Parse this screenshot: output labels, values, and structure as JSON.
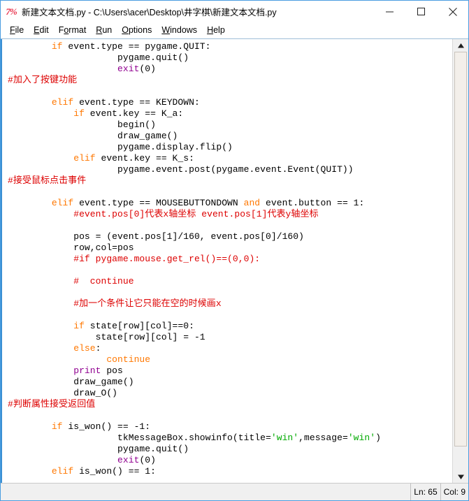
{
  "window": {
    "icon": "python-idle-icon",
    "title": "新建文本文档.py - C:\\Users\\acer\\Desktop\\井字棋\\新建文本文档.py",
    "minimize_label": "minimize-icon",
    "maximize_label": "maximize-icon",
    "close_label": "close-icon"
  },
  "menubar": {
    "items": [
      {
        "label": "File",
        "accel": "F"
      },
      {
        "label": "Edit",
        "accel": "E"
      },
      {
        "label": "Format",
        "accel": "o"
      },
      {
        "label": "Run",
        "accel": "R"
      },
      {
        "label": "Options",
        "accel": "O"
      },
      {
        "label": "Windows",
        "accel": "W"
      },
      {
        "label": "Help",
        "accel": "H"
      }
    ]
  },
  "editor": {
    "language": "python",
    "lines": [
      "        if event.type == pygame.QUIT:",
      "                    pygame.quit()",
      "                    exit(0)",
      "#加入了按键功能",
      "",
      "        elif event.type == KEYDOWN:",
      "            if event.key == K_a:",
      "                    begin()",
      "                    draw_game()",
      "                    pygame.display.flip()",
      "            elif event.key == K_s:",
      "                    pygame.event.post(pygame.event.Event(QUIT))",
      "#接受鼠标点击事件",
      "",
      "        elif event.type == MOUSEBUTTONDOWN and event.button == 1:",
      "            #event.pos[0]代表x轴坐标 event.pos[1]代表y轴坐标",
      "",
      "            pos = (event.pos[1]/160, event.pos[0]/160)",
      "            row,col=pos",
      "            #if pygame.mouse.get_rel()==(0,0):",
      "",
      "            #  continue",
      "",
      "            #加一个条件让它只能在空的时候画x",
      "",
      "            if state[row][col]==0:",
      "                state[row][col] = -1",
      "            else:",
      "                  continue",
      "            print pos",
      "            draw_game()",
      "            draw_O()",
      "#判断属性接受返回值",
      "",
      "        if is_won() == -1:",
      "                    tkMessageBox.showinfo(title='win',message='win')",
      "                    pygame.quit()",
      "                    exit(0)",
      "        elif is_won() == 1:"
    ]
  },
  "scrollbar": {
    "up_arrow": "scroll-up-arrow-icon",
    "down_arrow": "scroll-down-arrow-icon"
  },
  "statusbar": {
    "line_label": "Ln: 65",
    "col_label": "Col: 9"
  },
  "colors": {
    "keyword": "#ff7700",
    "builtin": "#900090",
    "comment": "#dd0000",
    "string": "#00aa00",
    "definition": "#0000ff",
    "window_border": "#4a9de0",
    "editor_left_bar": "#3b8fd4"
  }
}
